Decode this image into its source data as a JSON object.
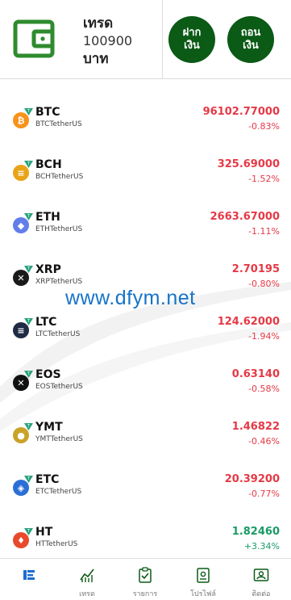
{
  "header": {
    "balance_label": "เทรด",
    "balance_amount": "100900",
    "balance_unit": "บาท",
    "deposit_label": "ฝาก\nเงิน",
    "withdraw_label": "ถอน\nเงิน",
    "brand_color": "#0b5a16"
  },
  "coins": [
    {
      "symbol": "BTC",
      "pair": "BTCTetherUS",
      "price": "96102.77000",
      "change": "-0.83%",
      "direction": "down",
      "icon": "bitcoin-icon",
      "icon_color": "#f7931a"
    },
    {
      "symbol": "BCH",
      "pair": "BCHTetherUS",
      "price": "325.69000",
      "change": "-1.52%",
      "direction": "down",
      "icon": "bitcoin-cash-icon",
      "icon_color": "#e8a317"
    },
    {
      "symbol": "ETH",
      "pair": "ETHTetherUS",
      "price": "2663.67000",
      "change": "-1.11%",
      "direction": "down",
      "icon": "ethereum-icon",
      "icon_color": "#627eea"
    },
    {
      "symbol": "XRP",
      "pair": "XRPTetherUS",
      "price": "2.70195",
      "change": "-0.80%",
      "direction": "down",
      "icon": "xrp-icon",
      "icon_color": "#1a1a1a"
    },
    {
      "symbol": "LTC",
      "pair": "LTCTetherUS",
      "price": "124.62000",
      "change": "-1.94%",
      "direction": "down",
      "icon": "litecoin-icon",
      "icon_color": "#1f2a44"
    },
    {
      "symbol": "EOS",
      "pair": "EOSTetherUS",
      "price": "0.63140",
      "change": "-0.58%",
      "direction": "down",
      "icon": "eos-icon",
      "icon_color": "#111111"
    },
    {
      "symbol": "YMT",
      "pair": "YMTTetherUS",
      "price": "1.46822",
      "change": "-0.46%",
      "direction": "down",
      "icon": "ymt-icon",
      "icon_color": "#c9a227"
    },
    {
      "symbol": "ETC",
      "pair": "ETCTetherUS",
      "price": "20.39200",
      "change": "-0.77%",
      "direction": "down",
      "icon": "ethereum-classic-icon",
      "icon_color": "#2b6fd6"
    },
    {
      "symbol": "HT",
      "pair": "HTTetherUS",
      "price": "1.82460",
      "change": "+3.34%",
      "direction": "up",
      "icon": "huobi-token-icon",
      "icon_color": "#e84a2c"
    }
  ],
  "watermark_text": "www.dfym.net",
  "tabs": [
    {
      "label": "",
      "icon": "home-logo-icon"
    },
    {
      "label": "เทรด",
      "icon": "chart-icon"
    },
    {
      "label": "รายการ",
      "icon": "clipboard-check-icon"
    },
    {
      "label": "โปรไฟล์",
      "icon": "profile-badge-icon"
    },
    {
      "label": "ติดต่อ",
      "icon": "contact-card-icon"
    }
  ],
  "colors": {
    "down": "#e53946",
    "up": "#1a9b68",
    "tab_icon": "#0b5a16"
  }
}
